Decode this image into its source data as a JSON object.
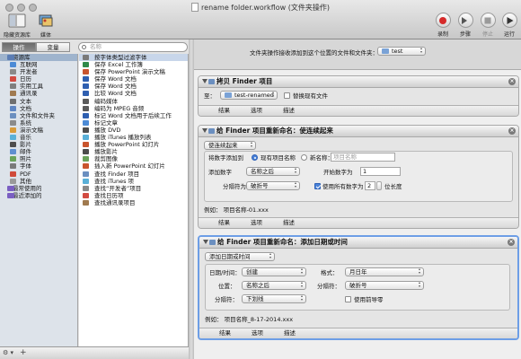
{
  "window": {
    "title": "rename folder.workflow (文件夹操作)"
  },
  "toolbar": {
    "show_library": "隐藏资源库",
    "media": "媒体",
    "record": "录制",
    "step": "步骤",
    "stop": "停止",
    "run": "运行"
  },
  "left": {
    "tab_actions": "操作",
    "tab_variables": "变量",
    "search_placeholder": "名称",
    "library": [
      {
        "label": "资源库",
        "color": "#5b7db4",
        "top": true
      },
      {
        "label": "互联网",
        "color": "#4c8bd6"
      },
      {
        "label": "开发者",
        "color": "#8a8a8a"
      },
      {
        "label": "日历",
        "color": "#d24b42"
      },
      {
        "label": "实用工具",
        "color": "#7f7f7f"
      },
      {
        "label": "通讯录",
        "color": "#a07a4f"
      },
      {
        "label": "文本",
        "color": "#6f6f6f"
      },
      {
        "label": "文档",
        "color": "#5f86c2"
      },
      {
        "label": "文件和文件夹",
        "color": "#6b8fc0"
      },
      {
        "label": "系统",
        "color": "#8b8b8b"
      },
      {
        "label": "演示文稿",
        "color": "#d89b3a"
      },
      {
        "label": "音乐",
        "color": "#5ab0d8"
      },
      {
        "label": "影片",
        "color": "#4d4d4d"
      },
      {
        "label": "邮件",
        "color": "#5f8fd0"
      },
      {
        "label": "照片",
        "color": "#6aa35a"
      },
      {
        "label": "字体",
        "color": "#7a7a7a"
      },
      {
        "label": "PDF",
        "color": "#d04a3a"
      },
      {
        "label": "其他",
        "color": "#9a9a9a"
      },
      {
        "label": "最常使用的",
        "color": "#7a5fc2",
        "group": true
      },
      {
        "label": "最近添加的",
        "color": "#7a5fc2",
        "group": true
      }
    ],
    "actions": [
      {
        "label": "按字体类型过滤字体",
        "color": "#7a7a7a",
        "selected": true
      },
      {
        "label": "保存 Excel 工作簿",
        "color": "#2f8a4a"
      },
      {
        "label": "保存 PowerPoint 演示文稿",
        "color": "#c9552e"
      },
      {
        "label": "保存 Word 文档",
        "color": "#2f5fb0"
      },
      {
        "label": "保存 Word 文档",
        "color": "#2f5fb0"
      },
      {
        "label": "比较 Word 文档",
        "color": "#2f5fb0"
      },
      {
        "label": "编码媒体",
        "color": "#5a5a5a"
      },
      {
        "label": "编码为 MPEG 音频",
        "color": "#5a5a5a"
      },
      {
        "label": "标记 Word 文档用于后续工作",
        "color": "#2f5fb0"
      },
      {
        "label": "标记文章",
        "color": "#4c8bd6"
      },
      {
        "label": "播放 DVD",
        "color": "#4d4d4d"
      },
      {
        "label": "播放 iTunes 播放列表",
        "color": "#5ab0d8"
      },
      {
        "label": "播放 PowerPoint 幻灯片",
        "color": "#c9552e"
      },
      {
        "label": "播放影片",
        "color": "#4d4d4d"
      },
      {
        "label": "裁剪图像",
        "color": "#6aa35a"
      },
      {
        "label": "插入新 PowerPoint 幻灯片",
        "color": "#c9552e"
      },
      {
        "label": "查找 Finder 项目",
        "color": "#6b8fc0"
      },
      {
        "label": "查找 iTunes 项",
        "color": "#5ab0d8"
      },
      {
        "label": "查找“开发者”项目",
        "color": "#8a8a8a"
      },
      {
        "label": "查找日历项",
        "color": "#d24b42"
      },
      {
        "label": "查找通讯录项目",
        "color": "#a07a4f"
      }
    ]
  },
  "receiver": {
    "label": "文件夹操作接收添加到这个位置的文件和文件夹：",
    "folder": "test"
  },
  "cards": {
    "copy": {
      "title": "拷贝 Finder 项目",
      "to_label": "至：",
      "destination": "test-renamed",
      "replace_label": "替换现有文件",
      "foot_results": "结果",
      "foot_options": "选项",
      "foot_description": "描述"
    },
    "rename1": {
      "title": "给 Finder 项目重新命名：使连续起来",
      "mode": "使连续起来",
      "add_number_label": "将数字添加到",
      "radio_existing": "现有项目名称",
      "radio_new": "新名称：",
      "new_name_placeholder": "项目名称",
      "position_label": "添加数字",
      "position_value": "名称之后",
      "start_label": "开始数字为",
      "start_value": "1",
      "separator_label": "分隔符为",
      "separator_value": "破折号",
      "digits_check_label": "使用所有数字为",
      "digits_value": "2",
      "digits_suffix": "位长度",
      "example": "例如： 项目名称-01.xxx",
      "foot_results": "结果",
      "foot_options": "选项",
      "foot_description": "描述"
    },
    "rename2": {
      "title": "给 Finder 项目重新命名：添加日期或时间",
      "mode": "添加日期或时间",
      "datetime_label": "日期/时间：",
      "datetime_value": "创建",
      "format_label": "格式：",
      "format_value": "月日年",
      "where_label": "位置：",
      "where_value": "名称之后",
      "sep_label": "分隔符：",
      "sep_value": "破折号",
      "sep2_label": "分隔符：",
      "sep2_value": "下划线",
      "leading_zero_label": "使用前导零",
      "example": "例如： 项目名称_8-17-2014.xxx",
      "foot_results": "结果",
      "foot_options": "选项",
      "foot_description": "描述"
    }
  }
}
